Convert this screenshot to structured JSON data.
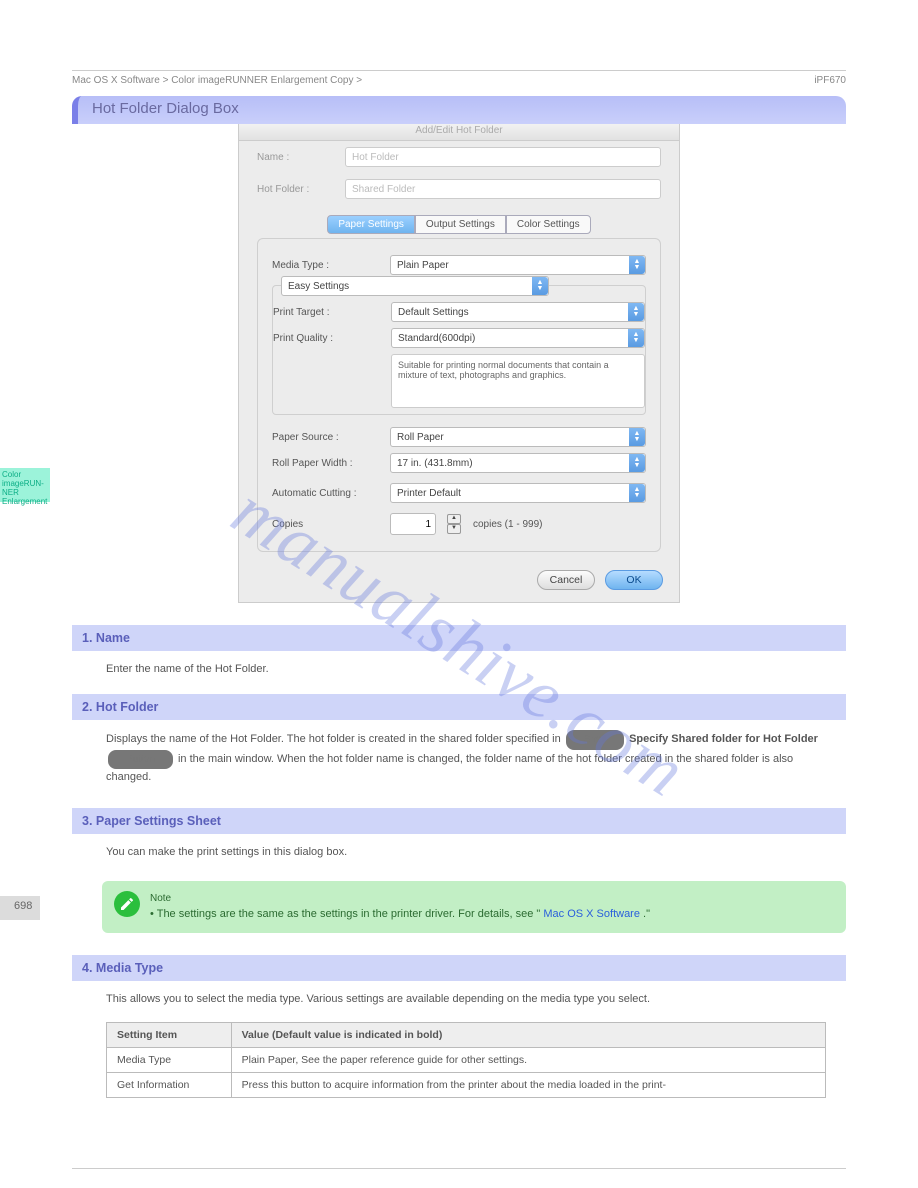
{
  "breadcrumb_left": "Mac OS X Software  >  Color imageRUNNER Enlargement Copy  >",
  "breadcrumb_right": "iPF670",
  "callout_title": "Hot Folder Dialog Box",
  "dialog": {
    "title": "Add/Edit Hot Folder",
    "name_label": "Name :",
    "name_value": "Hot Folder",
    "hotfolder_label": "Hot Folder :",
    "hotfolder_value": "Shared Folder",
    "tabs": {
      "paper": "Paper Settings",
      "output": "Output Settings",
      "color": "Color Settings"
    },
    "media_type_label": "Media Type :",
    "media_type_value": "Plain Paper",
    "easy_settings": "Easy Settings",
    "print_target_label": "Print Target :",
    "print_target_value": "Default Settings",
    "print_quality_label": "Print Quality :",
    "print_quality_value": "Standard(600dpi)",
    "description": "Suitable for printing normal documents that contain a mixture of text, photographs and graphics.",
    "paper_source_label": "Paper Source :",
    "paper_source_value": "Roll Paper",
    "roll_width_label": "Roll Paper Width :",
    "roll_width_value": "17 in. (431.8mm)",
    "auto_cut_label": "Automatic Cutting :",
    "auto_cut_value": "Printer Default",
    "copies_label": "Copies",
    "copies_value": "1",
    "copies_suffix": "copies (1 - 999)",
    "cancel": "Cancel",
    "ok": "OK"
  },
  "section_name": {
    "num": "1.",
    "title": "Name"
  },
  "name_text": "Enter the name of the Hot Folder.",
  "section_hotfolder": {
    "num": "2.",
    "title": "Hot Folder"
  },
  "hotfolder_text_before": "Displays the name of the Hot Folder. \nThe hot folder is created in the shared folder specified in",
  "hotfolder_text_link": "Specify Shared folder for Hot Folder",
  "hotfolder_text_after": " in the main window. When the hot folder name is changed, the folder name of the hot folder created in the shared folder is also changed.",
  "section_paper": {
    "num": "3.",
    "title": " Paper Settings Sheet"
  },
  "paper_text": "You can make the print settings in this dialog box.",
  "note_prefix": "Note",
  "note_dot": " • ",
  "note_text": "The settings are the same as the settings in the printer driver. For details, see \"",
  "note_link": "Mac OS X Software",
  "note_after": ".\"",
  "section_media": {
    "num": "4.",
    "title": "Media Type"
  },
  "media_text": "This allows you to select the media type. Various settings are available depending on the media type you select.",
  "table": {
    "headers": [
      "Setting Item",
      "Value (Default value is indicated in bold)"
    ],
    "rows": [
      [
        "Media Type",
        "Plain Paper, See the paper reference guide for other settings."
      ],
      [
        "Get Information",
        "Press this button to acquire information from the printer about the media loaded in the print-"
      ]
    ]
  },
  "side_tab": "Color imageRUN-NER Enlargement",
  "page_number": "698",
  "watermark": "manualshive.com"
}
